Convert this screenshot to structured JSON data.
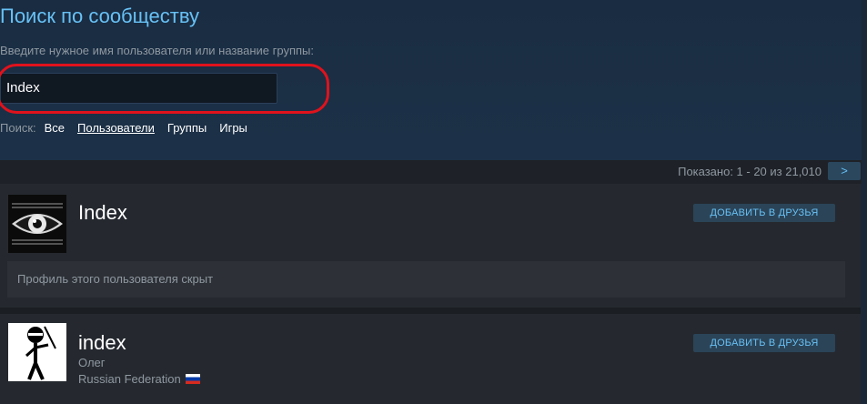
{
  "page": {
    "title": "Поиск по сообществу",
    "prompt": "Введите нужное имя пользователя или название группы:"
  },
  "search": {
    "value": "Index"
  },
  "filters": {
    "label": "Поиск:",
    "options": [
      "Все",
      "Пользователи",
      "Группы",
      "Игры"
    ],
    "active": "Пользователи"
  },
  "results": {
    "showing": "Показано: 1 - 20 из 21,010",
    "next_label": ">"
  },
  "items": [
    {
      "name": "Index",
      "add_friend_label": "ДОБАВИТЬ В ДРУЗЬЯ",
      "private_text": "Профиль этого пользователя скрыт",
      "avatar_icon": "eye-icon"
    },
    {
      "name": "index",
      "add_friend_label": "ДОБАВИТЬ В ДРУЗЬЯ",
      "real_name": "Олег",
      "country": "Russian Federation",
      "avatar_icon": "stickman-ninja-icon"
    }
  ],
  "colors": {
    "accent": "#67c1f5",
    "highlight": "#e0121c",
    "background": "#1b2838"
  }
}
